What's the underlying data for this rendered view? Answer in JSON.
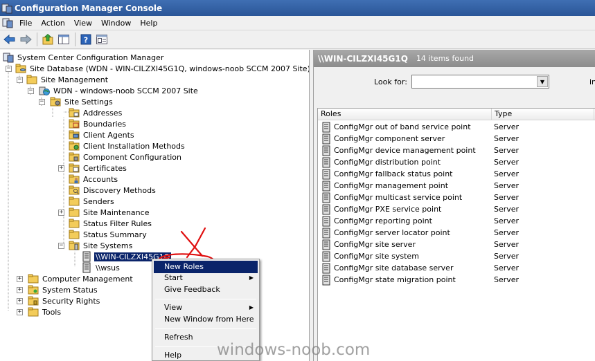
{
  "window": {
    "title": "Configuration Manager Console"
  },
  "menu": [
    "File",
    "Action",
    "View",
    "Window",
    "Help"
  ],
  "toolbar": {
    "buttons": [
      "back-arrow-icon",
      "forward-arrow-icon",
      "up-folder-icon",
      "show-hide-tree-icon",
      "help-icon",
      "properties-icon"
    ]
  },
  "tree": {
    "root": "System Center Configuration Manager",
    "site_database": "Site Database  (WDN - WIN-CILZXI45G1Q, windows-noob SCCM 2007 Site)",
    "site_management": "Site Management",
    "site": "WDN - windows-noob SCCM 2007 Site",
    "site_settings": "Site Settings",
    "settings_children": [
      "Addresses",
      "Boundaries",
      "Client Agents",
      "Client Installation Methods",
      "Component Configuration",
      "Certificates",
      "Accounts",
      "Discovery Methods",
      "Senders",
      "Site Maintenance",
      "Status Filter Rules",
      "Status Summary"
    ],
    "site_systems": "Site Systems",
    "site_system_nodes": [
      "\\\\WIN-CILZXI45G1Q",
      "\\\\wsus"
    ],
    "other_nodes": [
      "Computer Management",
      "System Status",
      "Security Rights",
      "Tools"
    ]
  },
  "details": {
    "path": "\\\\WIN-CILZXI45G1Q",
    "count": "14 items found",
    "look_for_label": "Look for:",
    "look_for_value": "",
    "in_label": "in",
    "columns": {
      "roles": "Roles",
      "type": "Type"
    },
    "rows": [
      {
        "role": "ConfigMgr out of band service point",
        "type": "Server"
      },
      {
        "role": "ConfigMgr component server",
        "type": "Server"
      },
      {
        "role": "ConfigMgr device management point",
        "type": "Server"
      },
      {
        "role": "ConfigMgr distribution point",
        "type": "Server"
      },
      {
        "role": "ConfigMgr fallback status point",
        "type": "Server"
      },
      {
        "role": "ConfigMgr management point",
        "type": "Server"
      },
      {
        "role": "ConfigMgr multicast service point",
        "type": "Server"
      },
      {
        "role": "ConfigMgr PXE service point",
        "type": "Server"
      },
      {
        "role": "ConfigMgr reporting point",
        "type": "Server"
      },
      {
        "role": "ConfigMgr server locator point",
        "type": "Server"
      },
      {
        "role": "ConfigMgr site server",
        "type": "Server"
      },
      {
        "role": "ConfigMgr site system",
        "type": "Server"
      },
      {
        "role": "ConfigMgr site database server",
        "type": "Server"
      },
      {
        "role": "ConfigMgr state migration point",
        "type": "Server"
      }
    ]
  },
  "context_menu": {
    "items": [
      {
        "label": "New Roles",
        "submenu": false
      },
      {
        "label": "Start",
        "submenu": true
      },
      {
        "label": "Give Feedback",
        "submenu": false
      },
      {
        "label": "View",
        "submenu": true
      },
      {
        "label": "New Window from Here",
        "submenu": false
      },
      {
        "label": "Refresh",
        "submenu": false
      },
      {
        "label": "Help",
        "submenu": false
      }
    ]
  },
  "watermark": "windows-noob.com",
  "colors": {
    "titlebar": "#2f5fa5",
    "selection": "#0a246a",
    "annotation_red": "#e01010"
  }
}
